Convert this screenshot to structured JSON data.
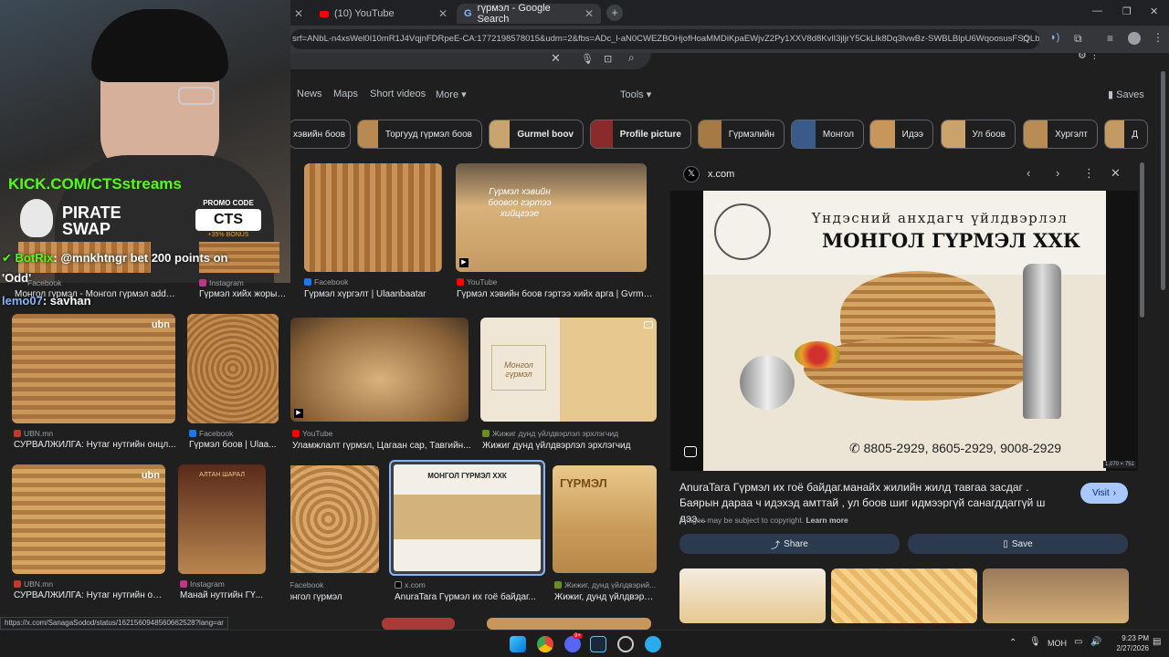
{
  "tabs": [
    {
      "label": ""
    },
    {
      "label": "(10) YouTube"
    },
    {
      "label": "гүрмэл - Google Search"
    }
  ],
  "address": {
    "url": "srf=ANbL-n4xsWel0I10mR1J4VqjnFDRpeE-CA:1772198578015&udm=2&fbs=ADc_l-aN0CWEZBOHjofHoaMMDiKpaEWjvZ2Py1XXV8d8KvlI3jljrY5CkLlk8Dq3lvwBz-SWBLBlpU6WqoosusFSQLbx..."
  },
  "nav": {
    "items": [
      "News",
      "Maps",
      "Short videos",
      "More"
    ],
    "tools": "Tools",
    "saves": "Saves"
  },
  "chips": [
    "хэвийн боов",
    "Торгууд гүрмэл боов",
    "Gurmel boov",
    "Profile picture",
    "Гүрмэлийн",
    "Монгол",
    "Идээ",
    "Ул боов",
    "Хургэлт",
    "Д"
  ],
  "results": [
    {
      "source": "Facebook",
      "caption": "Монгол гүрмэл - Монгол гүрмэл added..."
    },
    {
      "source": "Instagram",
      "caption": "Гүрмэл хийх жорын ..."
    },
    {
      "source": "Facebook",
      "caption": "Гүрмэл хүргэлт | Ulaanbaatar"
    },
    {
      "source": "YouTube",
      "caption": "Гүрмэл хэвийн боов гэртээ хийх арга | Gvrmel ..."
    },
    {
      "source": "UBN.mn",
      "caption": "СУРВАЛЖИЛГА: Нутаг нутгийн онцл..."
    },
    {
      "source": "Facebook",
      "caption": "Гүрмэл боов | Ulaa..."
    },
    {
      "source": "YouTube",
      "caption": "Уламжлалт гүрмэл, Цагаан сар, Тавгийн..."
    },
    {
      "source": "Жижиг дунд үйлдвэрлэл эрхлэгчид",
      "caption": "Жижиг дунд үйлдвэрлэл эрхлэгчид"
    },
    {
      "source": "UBN.mn",
      "caption": "СУРВАЛЖИЛГА: Нутаг нутгийн он..."
    },
    {
      "source": "Instagram",
      "caption": "Манай нутгийн ГҮ..."
    },
    {
      "source": "Facebook",
      "caption": "Монгол гүрмэл"
    },
    {
      "source": "x.com",
      "caption": "AnuraTara Гүрмэл их гоё байдаг..."
    },
    {
      "source": "Жижиг, дунд үйлдвэрий...",
      "caption": "Жижиг, дунд үйлдвэри..."
    }
  ],
  "thumb_text": {
    "ubn": "ubn",
    "yt_overlay": "Гүрмэл хэвийн боовоо гэртээ хийцгээе",
    "box_label": "Монгол гүрмэл",
    "gurmel_brand": "ГҮРМЭЛ",
    "altai": "АЛТАН ШАРАЛ"
  },
  "preview": {
    "site": "x.com",
    "banner_line1": "Үндэсний анхдагч үйлдвэрлэл",
    "banner_line2": "МОНГОЛ ГҮРМЭЛ ХХК",
    "phones": "8805-2929, 8605-2929, 9008-2929",
    "dimensions": "1,070 × 751",
    "description": "AnuraTara Гүрмэл их гоё байдаг.манайх жилийн жилд тавгаа засдаг . Баярын дараа ч идэхэд амттай , ул боов шиг идмээргүй санагддаггүй ш дээ...",
    "visit": "Visit",
    "copyright": "Images may be subject to copyright.",
    "learn_more": "Learn more",
    "share": "Share",
    "save": "Save"
  },
  "status_url": "https://x.com/SanagaSodod/status/1621560948560662528?lang=ar",
  "overlay": {
    "kick": "KICK.COM/CTSstreams",
    "pirate": "PIRATE",
    "swap": "SWAP",
    "promo_label": "PROMO CODE",
    "promo_code": "CTS",
    "promo_bonus": "+35% BONUS",
    "chat_user1": "BotRix",
    "chat_msg1": ": @mnkhtngr bet 200 points on",
    "chat_msg1b": "'Odd'",
    "chat_user2": "lemo07",
    "chat_msg2": ": savhan"
  },
  "taskbar": {
    "lang": "МОН",
    "time": "9:23 PM",
    "date": "2/27/2026",
    "badge": "9+"
  },
  "colors": {
    "accent": "#8ab4f8",
    "visit": "#a8c7fa",
    "kick": "#53fc18"
  }
}
